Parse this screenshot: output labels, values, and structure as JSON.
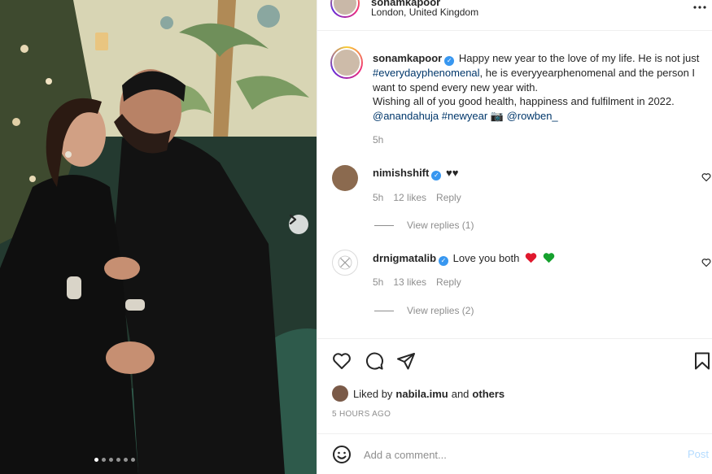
{
  "header": {
    "username": "sonamkapoor",
    "location": "London, United Kingdom",
    "more_icon": "ellipsis-icon"
  },
  "media": {
    "next_icon": "chevron-right-icon",
    "dot_count": 6,
    "active_dot": 0
  },
  "caption": {
    "username": "sonamkapoor",
    "line1": "Happy new year to the love of my life. He is not just",
    "hashtag1": "#everydayphenomenal",
    "line1b": ", he is everyyearphenomenal and the person I want to spend every new year with.",
    "line2": "Wishing all of you good health, happiness and fulfilment in 2022.",
    "mention1": "@anandahuja",
    "hashtag2": "#newyear",
    "camera": "📷",
    "mention2": "@rowben_",
    "time": "5h"
  },
  "comments": [
    {
      "username": "nimishshift",
      "text": "♥♥",
      "time": "5h",
      "likes": "12 likes",
      "reply_label": "Reply",
      "view_replies": "View replies (1)"
    },
    {
      "username": "drnigmatalib",
      "text": "Love you both",
      "time": "5h",
      "likes": "13 likes",
      "reply_label": "Reply",
      "view_replies": "View replies (2)"
    }
  ],
  "actions": {
    "like_icon": "heart-icon",
    "comment_icon": "comment-icon",
    "share_icon": "paper-plane-icon",
    "save_icon": "bookmark-icon"
  },
  "likes": {
    "prefix": "Liked by",
    "user": "nabila.imu",
    "joiner": "and",
    "others": "others"
  },
  "post_time": "5 HOURS AGO",
  "add_comment": {
    "placeholder": "Add a comment...",
    "post_label": "Post"
  },
  "colors": {
    "link": "#00376b",
    "verified": "#3897f0",
    "post_disabled": "#b3dbff"
  }
}
